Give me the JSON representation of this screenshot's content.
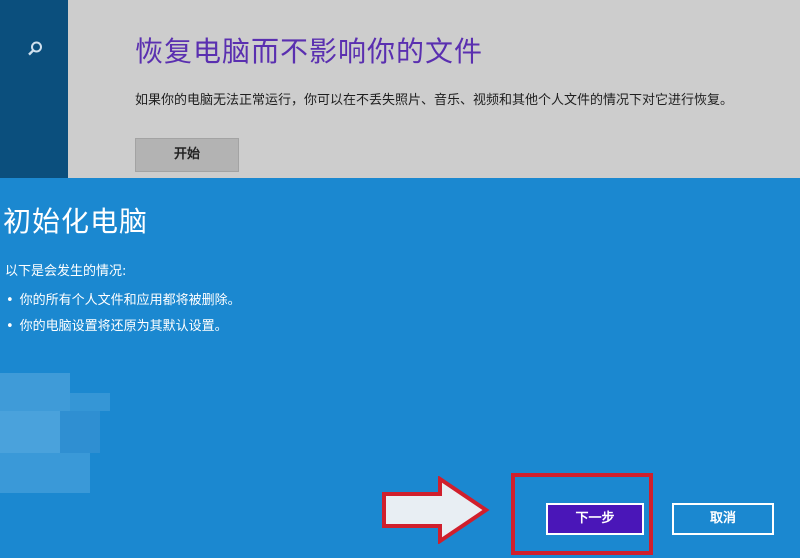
{
  "background_window": {
    "title": "恢复电脑而不影响你的文件",
    "description": "如果你的电脑无法正常运行，你可以在不丢失照片、音乐、视频和其他个人文件的情况下对它进行恢复。",
    "start_button": "开始",
    "search_icon": "search-icon"
  },
  "dialog": {
    "title": "初始化电脑",
    "subtitle": "以下是会发生的情况:",
    "items": [
      "你的所有个人文件和应用都将被删除。",
      "你的电脑设置将还原为其默认设置。"
    ],
    "next_button": "下一步",
    "cancel_button": "取消"
  },
  "colors": {
    "dialog_bg": "#1b88d0",
    "title_purple": "#5a2fb0",
    "next_button": "#4a16b8",
    "annotation_red": "#d01f2c"
  }
}
